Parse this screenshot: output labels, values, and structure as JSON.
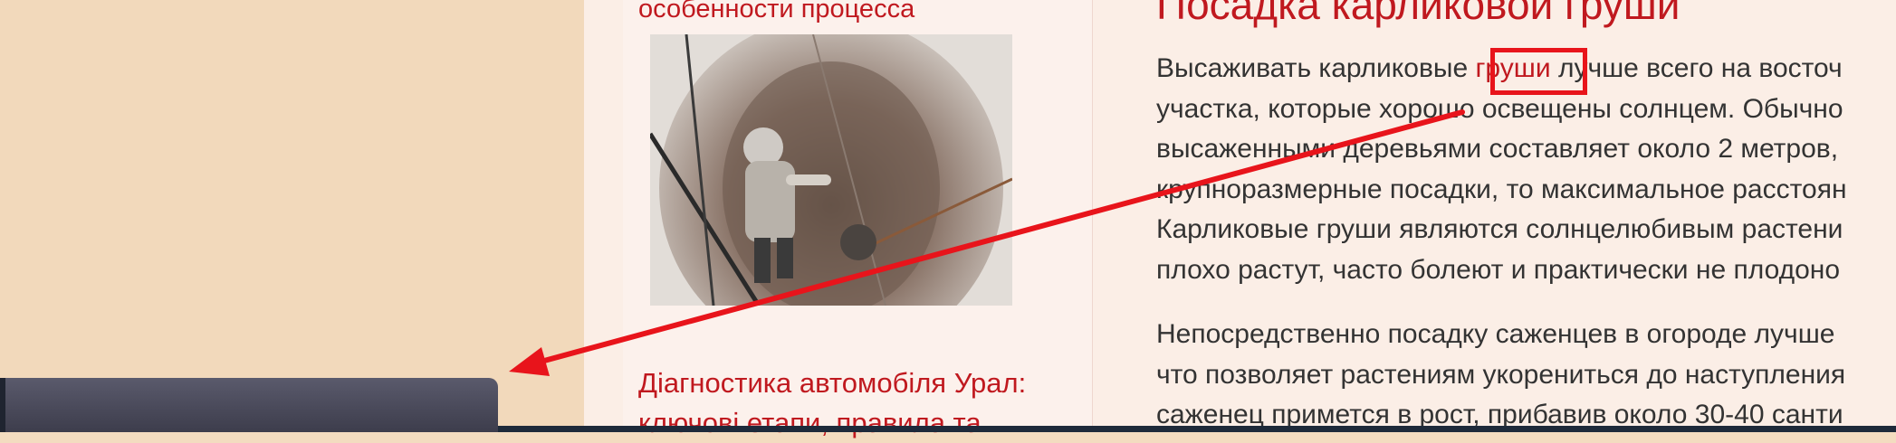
{
  "sidebar": {
    "article_title": "особенности процесса",
    "next_link": "Діагностика автомобіля Урал: ключові етапи, правила та"
  },
  "article": {
    "title": "Посадка карликовой груши",
    "paragraph1": {
      "line1_before": "Высаживать карликовые ",
      "line1_link": "груши",
      "line1_after": " лучше всего на восточ",
      "line2": "участка, которые хорошо освещены солнцем. Обычно",
      "line3": "высаженными деревьями составляет около 2 метров,",
      "line4": "крупноразмерные посадки, то максимальное расстоян",
      "line5": "Карликовые груши являются солнцелюбивым растени",
      "line6": "плохо растут, часто болеют и практически не плодоно"
    },
    "paragraph2": {
      "line1": "Непосредственно посадку саженцев в огороде лучше",
      "line2": "что позволяет растениям укорениться до наступления",
      "line3": "саженец примется в рост, прибавив около 30-40 санти"
    }
  },
  "annotation": {
    "highlight_color": "#e8141b",
    "arrow_color": "#e8141b"
  }
}
